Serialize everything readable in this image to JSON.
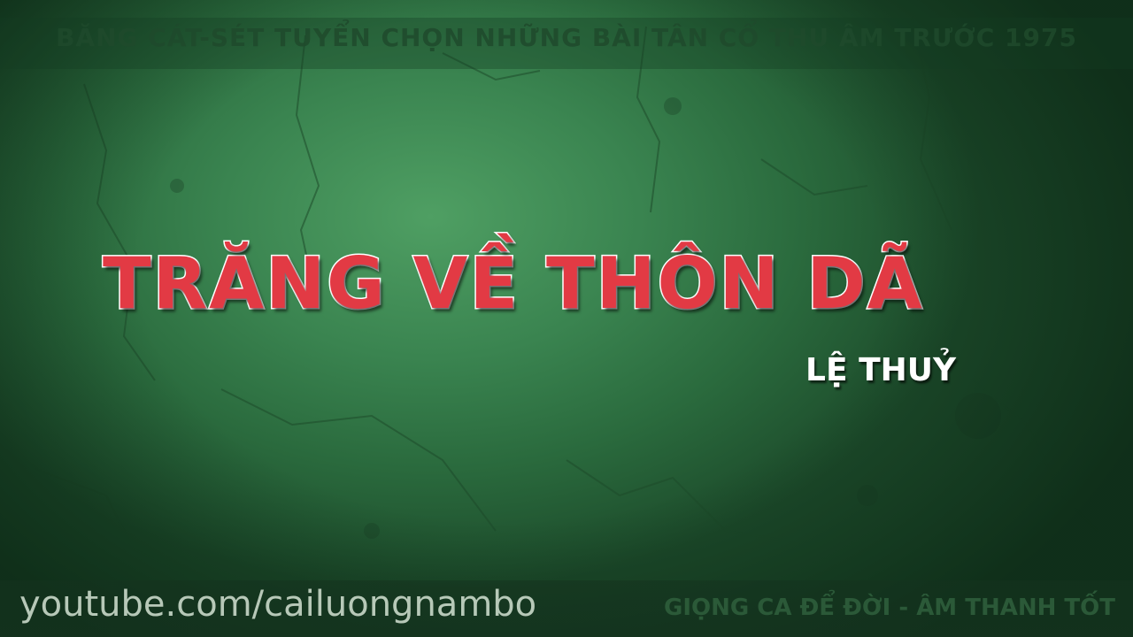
{
  "header": {
    "text": "BĂNG CÁT-SÉT TUYỂN CHỌN NHỮNG BÀI TÂN CỔ THU ÂM TRƯỚC 1975"
  },
  "song": {
    "title": "TRĂNG VỀ THÔN DÃ",
    "singer": "LỆ THUỶ"
  },
  "footer": {
    "channel_url": "youtube.com/cailuongnambo",
    "tagline": "GIỌNG CA ĐỂ ĐỜI - ÂM THANH TỐT"
  },
  "colors": {
    "background_green": "#3a8450",
    "title_red": "#e23a44",
    "title_outline": "#ffffff",
    "singer_text": "#ffffff"
  }
}
